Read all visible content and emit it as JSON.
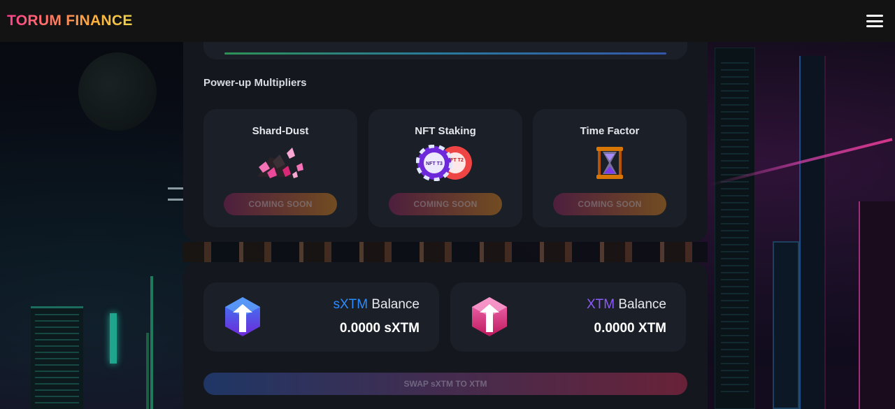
{
  "header": {
    "logo": "TORUM FINANCE",
    "menu_icon": "hamburger-menu-icon"
  },
  "multipliers": {
    "title": "Power-up Multipliers",
    "cards": [
      {
        "title": "Shard-Dust",
        "icon": "shard-dust-icon",
        "button": "COMING SOON"
      },
      {
        "title": "NFT Staking",
        "icon": "nft-chips-icon",
        "button": "COMING SOON",
        "chip_labels": [
          "NFT T3",
          "NFT T2"
        ]
      },
      {
        "title": "Time Factor",
        "icon": "hourglass-icon",
        "button": "COMING SOON"
      }
    ]
  },
  "balances": {
    "sxtm": {
      "token": "sXTM",
      "label": "Balance",
      "value": "0.0000 sXTM",
      "icon": "sxtm-token-icon"
    },
    "xtm": {
      "token": "XTM",
      "label": "Balance",
      "value": "0.0000 XTM",
      "icon": "xtm-token-icon"
    }
  },
  "swap": {
    "label": "SWAP sXTM TO XTM"
  },
  "colors": {
    "accent_blue": "#2a8cff",
    "accent_purple": "#8b5cf6",
    "logo_start": "#ff3f8e",
    "logo_end": "#f0d24a"
  }
}
